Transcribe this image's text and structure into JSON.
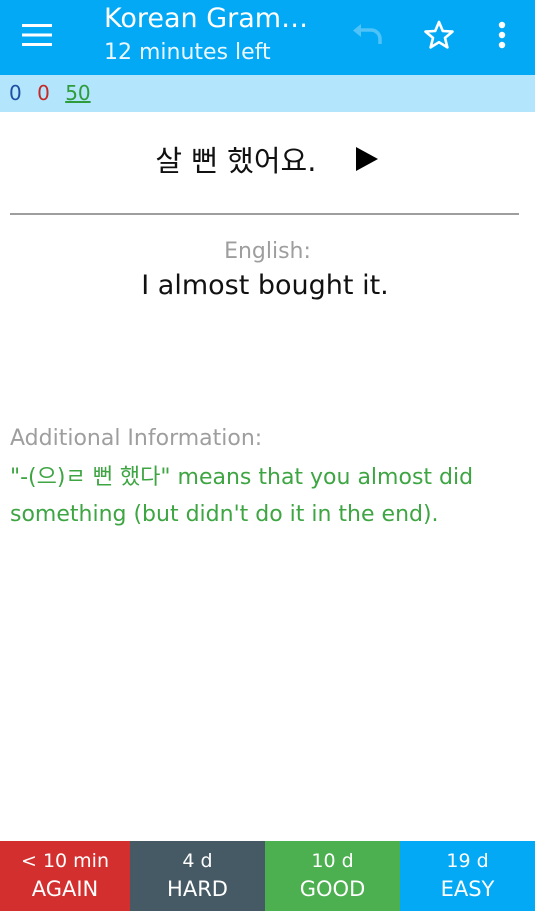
{
  "toolbar": {
    "title": "Korean Gram…",
    "subtitle": "12 minutes left",
    "icons": {
      "menu": "hamburger-menu-icon",
      "undo": "undo-icon",
      "star": "star-outline-icon",
      "overflow": "more-vert-icon"
    },
    "colors": {
      "background": "#03a9f4",
      "undo_disabled": "#4fc3f7"
    }
  },
  "counts": {
    "new": "0",
    "learning": "0",
    "review": "50",
    "colors": {
      "new": "#1f4fa3",
      "learning": "#c62828",
      "review": "#2e9c3a",
      "bar_background": "#b3e5fc"
    }
  },
  "card": {
    "question": "살 뻔 했어요.",
    "play_icon": "play-audio-icon",
    "english_label": "English:",
    "english_text": "I almost bought it.",
    "info_label": "Additional Information:",
    "info_text": "\"-(으)ㄹ 뻔 했다\" means that you almost did something (but didn't do it in the end).",
    "colors": {
      "label": "#9e9e9e",
      "info_text": "#3ea543"
    }
  },
  "answers": [
    {
      "interval": "< 10 min",
      "label": "AGAIN",
      "color": "#d32f2f"
    },
    {
      "interval": "4 d",
      "label": "HARD",
      "color": "#455a64"
    },
    {
      "interval": "10 d",
      "label": "GOOD",
      "color": "#4caf50"
    },
    {
      "interval": "19 d",
      "label": "EASY",
      "color": "#03a9f4"
    }
  ]
}
